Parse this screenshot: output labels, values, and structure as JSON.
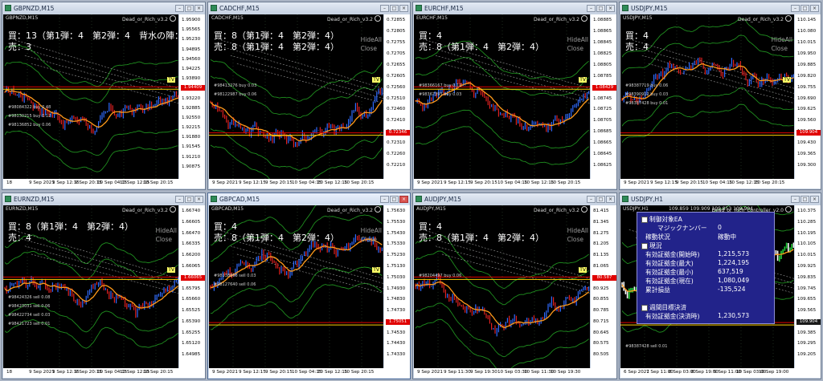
{
  "ea_name": "Dead_or_Rich_v3.2",
  "windows": [
    {
      "symbol": "GBPNZD,M15",
      "position_text": [
        "買：13（第1弾：4　第2弾：4　背水の陣：5）",
        "売：3"
      ],
      "prices": [
        "1.95900",
        "1.95565",
        "1.95230",
        "1.94895",
        "1.94560",
        "1.94225",
        "1.93890",
        "1.93555",
        "1.93220",
        "1.92885",
        "1.92550",
        "1.92215",
        "1.91880",
        "1.91545",
        "1.91210",
        "1.90875"
      ],
      "current_price": "1.94409",
      "x_labels": [
        "18",
        "9 Sep 2021",
        "9 Sep 12:15",
        "9 Sep 20:15",
        "10 Sep 04:15",
        "10 Sep 12:15",
        "10 Sep 20:15"
      ],
      "orders": [
        "#98084322 buy 0.48",
        "#98130215 buy 0.12",
        "#98136852 buy 0.06"
      ],
      "tv": "TV",
      "hide_all": "",
      "close": ""
    },
    {
      "symbol": "CADCHF,M15",
      "position_text": [
        "買：8（第1弾：4　第2弾：4）",
        "売：8（第1弾：4　第2弾：4）"
      ],
      "prices": [
        "0.72855",
        "0.72805",
        "0.72755",
        "0.72705",
        "0.72655",
        "0.72605",
        "0.72560",
        "0.72510",
        "0.72460",
        "0.72410",
        "0.72360",
        "0.72310",
        "0.72260",
        "0.72210"
      ],
      "current_price": "0.72346",
      "x_labels": [
        "9 Sep 2021",
        "9 Sep 12:15",
        "9 Sep 20:15",
        "10 Sep 04:15",
        "10 Sep 12:15",
        "10 Sep 20:15"
      ],
      "orders": [
        "#98413276 buy 0.03",
        "#98122987 buy 0.06"
      ],
      "tv": "TV",
      "hide_all": "HideAll",
      "close": "Close"
    },
    {
      "symbol": "EURCHF,M15",
      "position_text": [
        "買：4",
        "売：8（第1弾：4　第2弾：4）"
      ],
      "prices": [
        "1.08885",
        "1.08865",
        "1.08845",
        "1.08825",
        "1.08805",
        "1.08785",
        "1.08765",
        "1.08745",
        "1.08725",
        "1.08705",
        "1.08685",
        "1.08665",
        "1.08645",
        "1.08625"
      ],
      "current_price": "1.08429",
      "x_labels": [
        "9 Sep 2021",
        "9 Sep 12:15",
        "9 Sep 20:15",
        "10 Sep 04:15",
        "10 Sep 12:15",
        "10 Sep 20:15"
      ],
      "orders": [
        "#98366167 buy 0.12",
        "#98367395 buy 0.03"
      ],
      "tv": "TV",
      "hide_all": "HideAll",
      "close": "Close"
    },
    {
      "symbol": "USDJPY,M15",
      "position_text": [
        "買：4",
        "売：4"
      ],
      "prices": [
        "110.145",
        "110.080",
        "110.015",
        "109.950",
        "109.885",
        "109.820",
        "109.755",
        "109.690",
        "109.625",
        "109.560",
        "109.495",
        "109.430",
        "109.365",
        "109.300"
      ],
      "current_price": "109.904",
      "x_labels": [
        "9 Sep 2021",
        "9 Sep 12:15",
        "9 Sep 20:15",
        "10 Sep 04:15",
        "10 Sep 12:15",
        "10 Sep 20:15"
      ],
      "orders": [
        "#98387719 buy 0.06",
        "#98390912 buy 0.03",
        "#98387428 buy 0.01"
      ],
      "tv": "TV",
      "hide_all": "HideAll",
      "close": "Close"
    },
    {
      "symbol": "EURNZD,M15",
      "position_text": [
        "買：8（第1弾：4　第2弾：4）",
        "売：4"
      ],
      "prices": [
        "1.66740",
        "1.66605",
        "1.66470",
        "1.66335",
        "1.66200",
        "1.66065",
        "1.65930",
        "1.65795",
        "1.65660",
        "1.65525",
        "1.65390",
        "1.65255",
        "1.65120",
        "1.64985"
      ],
      "current_price": "1.66065",
      "x_labels": [
        "18",
        "9 Sep 2021",
        "9 Sep 12:15",
        "9 Sep 20:15",
        "10 Sep 04:15",
        "10 Sep 12:15",
        "10 Sep 20:15"
      ],
      "orders": [
        "#98424326 sell 0.08",
        "#98423031 sell 0.06",
        "#98422734 sell 0.03",
        "#98421723 sell 0.01"
      ],
      "tv": "TV",
      "hide_all": "HideAll",
      "close": "Close"
    },
    {
      "symbol": "GBPCAD,M15",
      "position_text": [
        "買：4",
        "売：8（第1弾：4　第2弾：4）"
      ],
      "prices": [
        "1.75630",
        "1.75530",
        "1.75430",
        "1.75330",
        "1.75230",
        "1.75130",
        "1.75030",
        "1.74930",
        "1.74830",
        "1.74730",
        "1.74630",
        "1.74530",
        "1.74430",
        "1.74330"
      ],
      "current_price": "1.75051",
      "x_labels": [
        "9 Sep 2021",
        "9 Sep 12:15",
        "9 Sep 20:15",
        "10 Sep 04:15",
        "10 Sep 12:15",
        "10 Sep 20:15"
      ],
      "orders": [
        "#98138868 sell 0.03",
        "#98127640 sell 0.06"
      ],
      "tv": "TV",
      "hide_all": "HideAll",
      "close": "Close"
    },
    {
      "symbol": "AUDJPY,M15",
      "position_text": [
        "買：4",
        "売：8（第1弾：4　第2弾：4）"
      ],
      "prices": [
        "81.415",
        "81.345",
        "81.275",
        "81.205",
        "81.135",
        "81.065",
        "80.995",
        "80.925",
        "80.855",
        "80.785",
        "80.715",
        "80.645",
        "80.575",
        "80.505"
      ],
      "current_price": "80.587",
      "x_labels": [
        "9 Sep 2021",
        "9 Sep 11:30",
        "9 Sep 19:30",
        "10 Sep 03:30",
        "10 Sep 11:30",
        "10 Sep 19:30"
      ],
      "orders": [
        "#98204497 buy 0.06"
      ],
      "tv": "TV",
      "hide_all": "HideAll",
      "close": "Close"
    },
    {
      "symbol": "USDJPY,H1",
      "ohlc": "109.859 109.909 109.853 109.904",
      "ea_name": "Dead_or_Rich_Controller_v2.0",
      "prices": [
        "110.375",
        "110.285",
        "110.195",
        "110.105",
        "110.015",
        "109.925",
        "109.835",
        "109.745",
        "109.655",
        "109.565",
        "109.475",
        "109.385",
        "109.295",
        "109.205"
      ],
      "current_price": "109.904",
      "x_labels": [
        "6 Sep 2021",
        "7 Sep 11:00",
        "8 Sep 03:00",
        "8 Sep 19:00",
        "9 Sep 11:00",
        "10 Sep 03:00",
        "10 Sep 19:00"
      ],
      "orders": [
        "#98387428 sell 0.01"
      ]
    }
  ],
  "controller": {
    "section1_title": "制御対象EA",
    "magic_label": "マジックナンバー",
    "magic_value": "0",
    "status_label": "稼動状況",
    "status_value": "稼動中",
    "section2_title": "現況",
    "rows": [
      {
        "label": "有効証拠金(開始時)",
        "value": "1,215,573"
      },
      {
        "label": "有効証拠金(最大)",
        "value": "1,224,195"
      },
      {
        "label": "有効証拠金(最小)",
        "value": "637,519"
      },
      {
        "label": "有効証拠金(現在)",
        "value": "1,080,049"
      },
      {
        "label": "累計損益",
        "value": "-135,524"
      }
    ],
    "section3_title": "週間目標決済",
    "target_label": "有効証拠金(決済時)",
    "target_value": "1,230,573"
  },
  "colors": {
    "accent_orange": "#ff9a1a",
    "band_green": "#1f8f1f",
    "price_red": "#e00000",
    "panel_navy": "#22238a"
  }
}
